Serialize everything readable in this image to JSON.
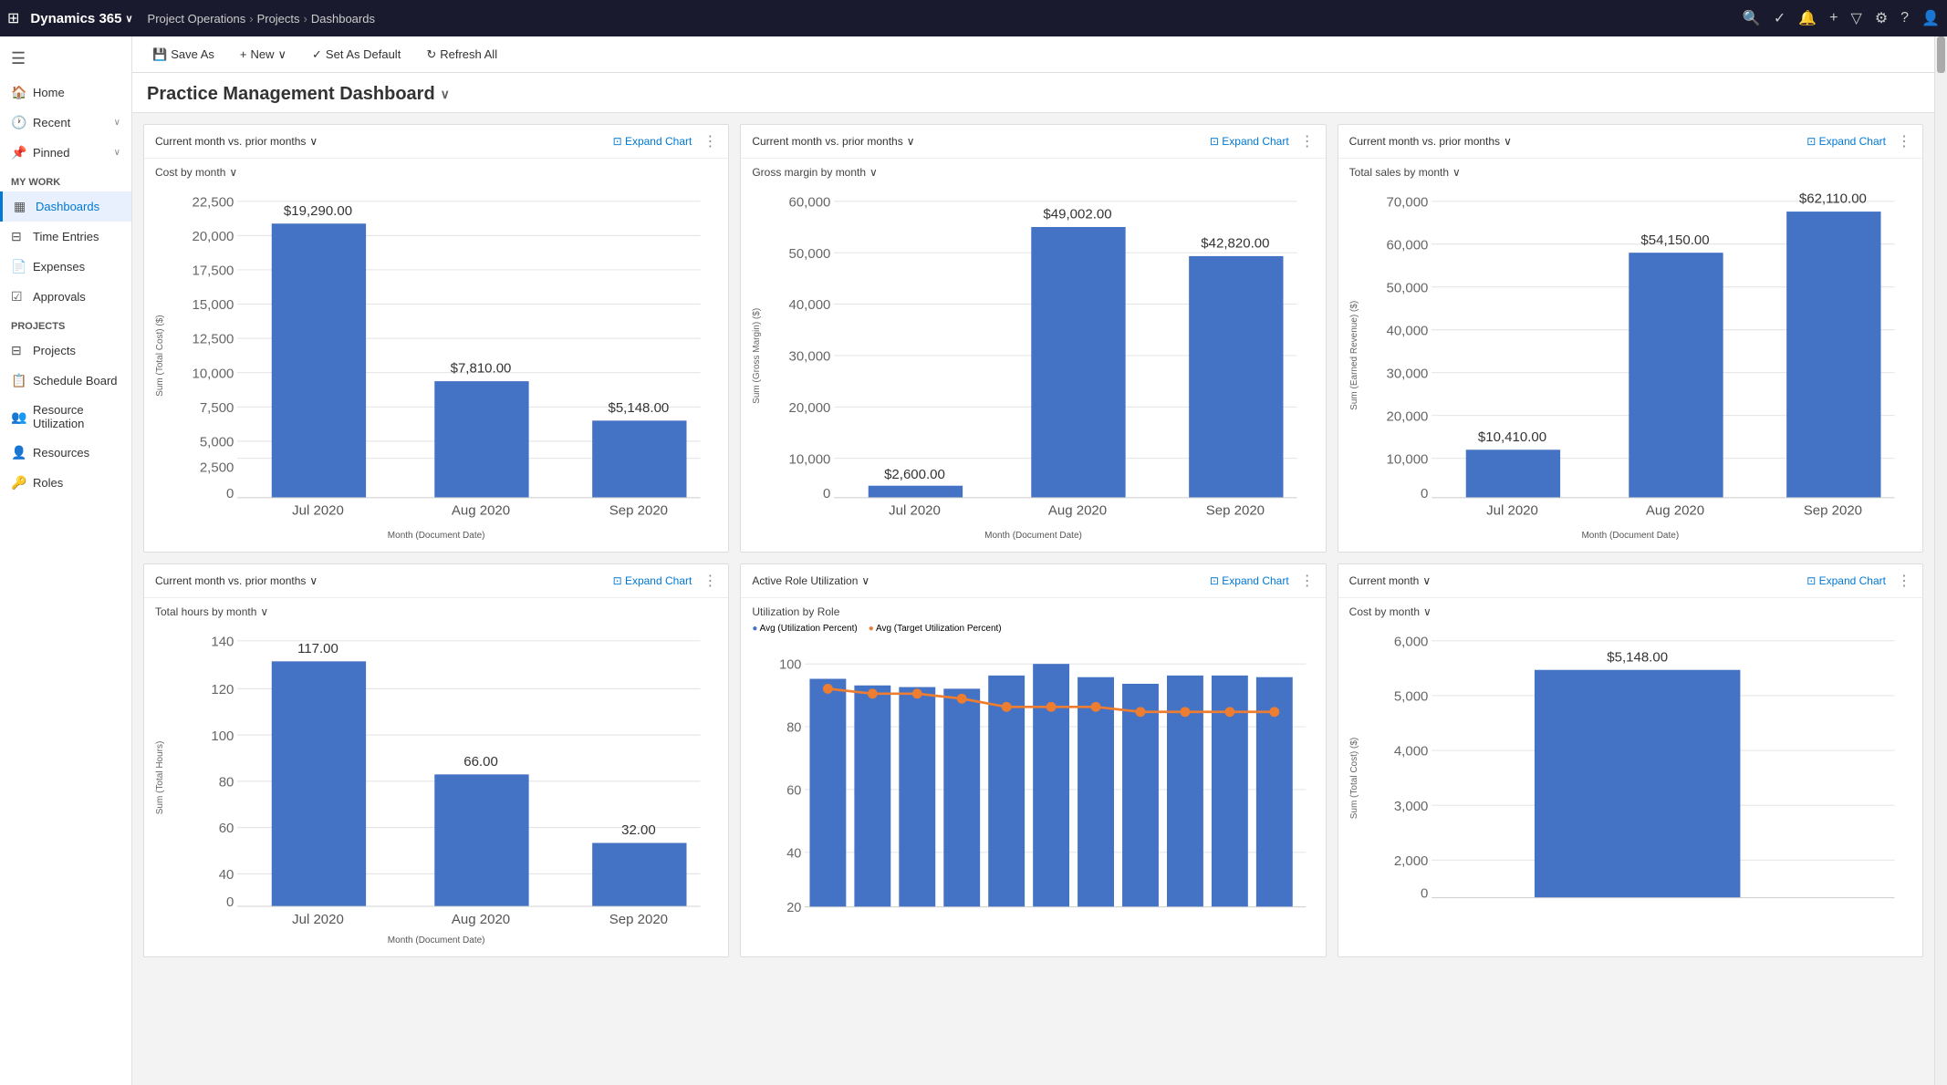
{
  "brand": {
    "name": "Dynamics 365",
    "chevron": "∨"
  },
  "breadcrumb": {
    "items": [
      "Project Operations",
      "Projects",
      "Dashboards"
    ]
  },
  "toolbar": {
    "save_as": "Save As",
    "new": "New",
    "set_as_default": "Set As Default",
    "refresh_all": "Refresh All"
  },
  "page": {
    "title": "Practice Management Dashboard"
  },
  "sidebar": {
    "hamburger": "☰",
    "home": "Home",
    "recent": "Recent",
    "pinned": "Pinned",
    "my_work_header": "My Work",
    "my_work": [
      {
        "id": "dashboards",
        "label": "Dashboards",
        "active": true
      },
      {
        "id": "time-entries",
        "label": "Time Entries"
      },
      {
        "id": "expenses",
        "label": "Expenses"
      },
      {
        "id": "approvals",
        "label": "Approvals"
      }
    ],
    "projects_header": "Projects",
    "projects": [
      {
        "id": "projects",
        "label": "Projects"
      },
      {
        "id": "schedule-board",
        "label": "Schedule Board"
      },
      {
        "id": "resource-utilization",
        "label": "Resource Utilization"
      },
      {
        "id": "resources",
        "label": "Resources"
      },
      {
        "id": "roles",
        "label": "Roles"
      }
    ]
  },
  "charts": {
    "row1": [
      {
        "id": "cost-by-month",
        "header_filter": "Current month vs. prior months",
        "title": "Cost by month",
        "y_label": "Sum (Total Cost) ($)",
        "x_label": "Month (Document Date)",
        "expand_label": "Expand Chart",
        "y_ticks": [
          "22,500.00",
          "20,000.00",
          "17,500.00",
          "15,000.00",
          "12,500.00",
          "10,000.00",
          "7,500.00",
          "5,000.00",
          "2,500.00",
          "0.00"
        ],
        "bars": [
          {
            "label": "Jul 2020",
            "value": 19290,
            "display": "$19,290.00",
            "height_pct": 86
          },
          {
            "label": "Aug 2020",
            "value": 7810,
            "display": "$7,810.00",
            "height_pct": 35
          },
          {
            "label": "Sep 2020",
            "value": 5148,
            "display": "$5,148.00",
            "height_pct": 23
          }
        ]
      },
      {
        "id": "gross-margin-by-month",
        "header_filter": "Current month vs. prior months",
        "title": "Gross margin by month",
        "y_label": "Sum (Gross Margin) ($)",
        "x_label": "Month (Document Date)",
        "expand_label": "Expand Chart",
        "y_ticks": [
          "60,000.00",
          "50,000.00",
          "40,000.00",
          "30,000.00",
          "20,000.00",
          "10,000.00",
          "0.00"
        ],
        "bars": [
          {
            "label": "Jul 2020",
            "value": 2600,
            "display": "$2,600.00",
            "height_pct": 4
          },
          {
            "label": "Aug 2020",
            "value": 49002,
            "display": "$49,002.00",
            "height_pct": 82
          },
          {
            "label": "Sep 2020",
            "value": 42820,
            "display": "$42,820.00",
            "height_pct": 71
          }
        ]
      },
      {
        "id": "total-sales-by-month",
        "header_filter": "Current month vs. prior months",
        "title": "Total sales by month",
        "y_label": "Sum (Earned Revenue) ($)",
        "x_label": "Month (Document Date)",
        "expand_label": "Expand Chart",
        "y_ticks": [
          "70,000.00",
          "60,000.00",
          "50,000.00",
          "40,000.00",
          "30,000.00",
          "20,000.00",
          "10,000.00",
          "0.00"
        ],
        "bars": [
          {
            "label": "Jul 2020",
            "value": 10410,
            "display": "$10,410.00",
            "height_pct": 15
          },
          {
            "label": "Aug 2020",
            "value": 54150,
            "display": "$54,150.00",
            "height_pct": 77
          },
          {
            "label": "Sep 2020",
            "value": 62110,
            "display": "$62,110.00",
            "height_pct": 89
          }
        ]
      }
    ],
    "row2": [
      {
        "id": "total-hours-by-month",
        "header_filter": "Current month vs. prior months",
        "title": "Total hours by month",
        "y_label": "Sum (Total Hours)",
        "x_label": "Month (Document Date)",
        "expand_label": "Expand Chart",
        "y_ticks": [
          "140.00",
          "120.00",
          "100.00",
          "80.00",
          "60.00",
          "40.00"
        ],
        "bars": [
          {
            "label": "Jul 2020",
            "value": 117,
            "display": "117.00",
            "height_pct": 84
          },
          {
            "label": "Aug 2020",
            "value": 66,
            "display": "66.00",
            "height_pct": 47
          },
          {
            "label": "Sep 2020",
            "value": 32,
            "display": "32.00",
            "height_pct": 23
          }
        ]
      },
      {
        "id": "active-role-utilization",
        "header_filter": "Active Role Utilization",
        "title": "Utilization by Role",
        "expand_label": "Expand Chart",
        "legend": [
          {
            "label": "Avg (Utilization Percent)",
            "color": "#4472C4"
          },
          {
            "label": "Avg (Target Utilization Percent)",
            "color": "#ED7D31"
          }
        ],
        "bar_values": [
          93,
          88,
          87,
          86,
          90,
          95,
          92,
          89,
          93,
          93,
          92
        ],
        "line_values": [
          90,
          88,
          88,
          86,
          82,
          82,
          82,
          80,
          80,
          80,
          80
        ]
      },
      {
        "id": "cost-by-month-current",
        "header_filter": "Current month",
        "title": "Cost by month",
        "y_label": "Sum (Total Cost) ($)",
        "x_label": "",
        "expand_label": "Expand Chart",
        "y_ticks": [
          "6,000.00",
          "5,000.00",
          "4,000.00",
          "3,000.00",
          "2,000.00"
        ],
        "bars": [
          {
            "label": "",
            "value": 5148,
            "display": "$5,148.00",
            "height_pct": 86
          }
        ]
      }
    ]
  },
  "top_icons": [
    "🔍",
    "✓",
    "🔔",
    "+",
    "▽",
    "⚙",
    "?",
    "👤"
  ]
}
